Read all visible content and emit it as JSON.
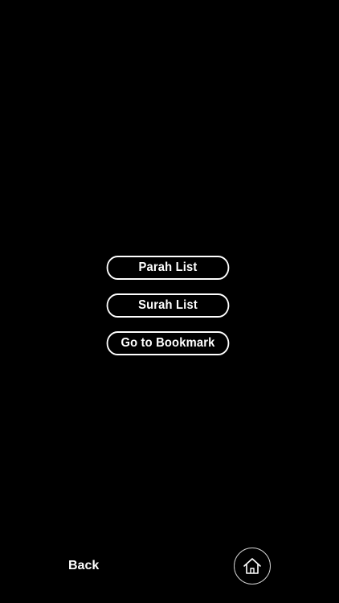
{
  "menu": {
    "items": [
      {
        "label": "Parah List"
      },
      {
        "label": "Surah List"
      },
      {
        "label": "Go to Bookmark"
      }
    ]
  },
  "footer": {
    "back_label": "Back",
    "home_icon": "home-icon"
  },
  "colors": {
    "background": "#000000",
    "foreground": "#ffffff"
  }
}
